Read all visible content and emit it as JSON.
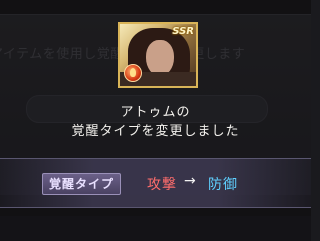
{
  "background": {
    "instruction_text": "アイテムを使用し覚醒タイプを変更します"
  },
  "portrait": {
    "rarity": "SSR",
    "element": "fire-icon"
  },
  "message": {
    "line1": "アトゥムの",
    "line2": "覚醒タイプを変更しました"
  },
  "result": {
    "label": "覚醒タイプ",
    "from": "攻撃",
    "arrow": "→",
    "to": "防御"
  },
  "colors": {
    "from_color": "#ff6d6d",
    "to_color": "#5fd0ff",
    "frame_gold": "#d9b458"
  }
}
